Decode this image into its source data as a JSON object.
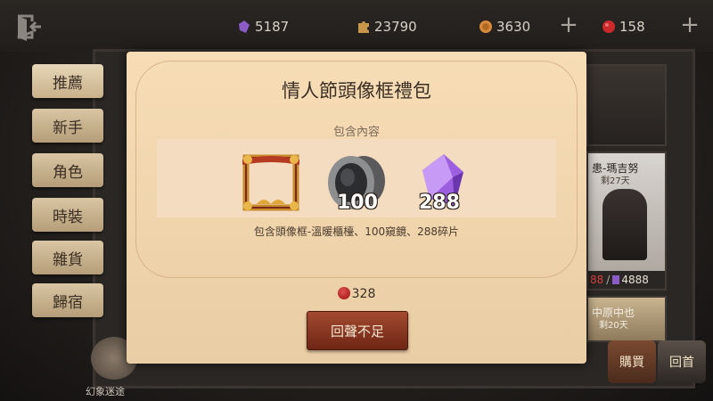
{
  "currencies": [
    {
      "name": "gem",
      "value": "5187",
      "color": "#8b5cc8"
    },
    {
      "name": "puzzle",
      "value": "23790",
      "color": "#c7964a"
    },
    {
      "name": "coin",
      "value": "3630",
      "color": "#d98a3b"
    },
    {
      "name": "red-ruby",
      "value": "158",
      "color": "#cc2a2a"
    }
  ],
  "sidebar": {
    "items": [
      {
        "label": "推薦"
      },
      {
        "label": "新手"
      },
      {
        "label": "角色"
      },
      {
        "label": "時裝"
      },
      {
        "label": "雜貨"
      },
      {
        "label": "歸宿"
      }
    ]
  },
  "background_cards": {
    "card1_title": "患-瑪吉努",
    "card1_subtitle": "剩27天",
    "card1_price_prefix": "88",
    "card1_price": "4888",
    "card2_title": "中原中也",
    "card2_subtitle": "剩20天"
  },
  "bottom_left": {
    "label": "幻象迷途"
  },
  "bottom_buttons": {
    "buy": "購買",
    "back": "回首"
  },
  "dialog": {
    "title": "情人節頭像框禮包",
    "subtitle": "包含內容",
    "items": [
      {
        "icon": "avatar-frame-icon",
        "quantity": ""
      },
      {
        "icon": "mirror-icon",
        "quantity": "100"
      },
      {
        "icon": "crystal-shard-icon",
        "quantity": "288"
      }
    ],
    "description": "包含頭像框-溫暖櫃檯、100窺鏡、288碎片",
    "price": "328",
    "action_label": "回聲不足"
  }
}
